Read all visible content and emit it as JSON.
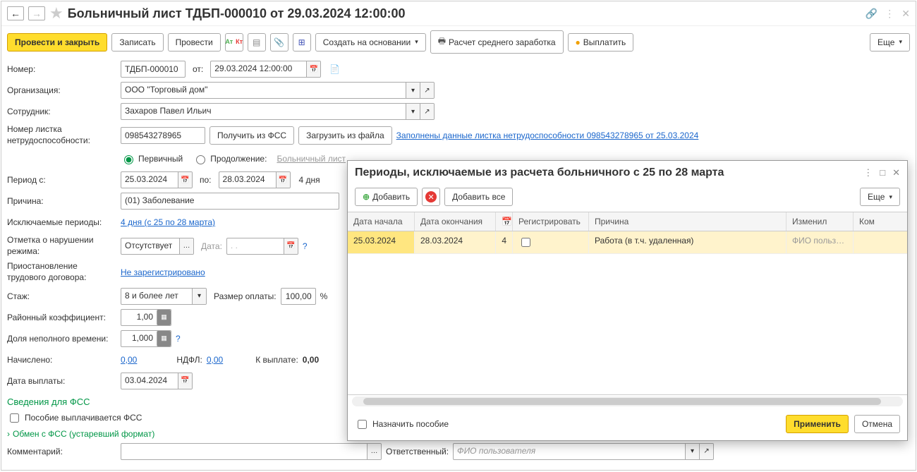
{
  "title": "Больничный лист ТДБП-000010 от 29.03.2024 12:00:00",
  "toolbar": {
    "post_close": "Провести и закрыть",
    "save": "Записать",
    "post": "Провести",
    "create_based": "Создать на основании",
    "avg_calc": "Расчет среднего заработка",
    "pay": "Выплатить",
    "more": "Еще"
  },
  "labels": {
    "number": "Номер:",
    "from": "от:",
    "org": "Организация:",
    "employee": "Сотрудник:",
    "cert_number": "Номер листка нетрудоспособности:",
    "get_fss": "Получить из ФСС",
    "load_file": "Загрузить из файла",
    "cert_link": "Заполнены данные листка нетрудоспособности 098543278965 от 25.03.2024",
    "primary": "Первичный",
    "continuation": "Продолжение:",
    "sick_leave_link": "Больничный лист",
    "period_from": "Период с:",
    "period_to": "по:",
    "days": "4 дня",
    "reason": "Причина:",
    "excl_periods": "Исключаемые периоды:",
    "excl_link": "4 дня (с 25 по 28 марта)",
    "violation": "Отметка о нарушении режима:",
    "date_lbl": "Дата:",
    "suspension": "Приостановление трудового договора:",
    "not_registered": "Не зарегистрировано",
    "seniority": "Стаж:",
    "pay_rate": "Размер оплаты:",
    "pct": "%",
    "district": "Районный коэффициент:",
    "parttime": "Доля неполного времени:",
    "accrued": "Начислено:",
    "ndfl": "НДФЛ:",
    "to_pay": "К выплате:",
    "pay_date": "Дата выплаты:",
    "fss_section": "Сведения для ФСС",
    "fss_pays": "Пособие выплачивается ФСС",
    "fss_exchange": "Обмен с ФСС (устаревший формат)",
    "comment": "Комментарий:",
    "responsible": "Ответственный:",
    "responsible_value": "ФИО пользователя"
  },
  "values": {
    "number": "ТДБП-000010",
    "date": "29.03.2024 12:00:00",
    "org": "ООО \"Торговый дом\"",
    "employee": "Захаров Павел Ильич",
    "cert_number": "098543278965",
    "period_from": "25.03.2024",
    "period_to": "28.03.2024",
    "reason": "(01) Заболевание",
    "violation": "Отсутствует",
    "date_empty": "  .  .    ",
    "seniority": "8 и более лет",
    "pay_rate": "100,00",
    "district": "1,00",
    "parttime": "1,000",
    "accrued": "0,00",
    "ndfl": "0,00",
    "to_pay": "0,00",
    "pay_date": "03.04.2024"
  },
  "modal": {
    "title": "Периоды, исключаемые из расчета больничного с 25 по 28 марта",
    "add": "Добавить",
    "add_all": "Добавить все",
    "more": "Еще",
    "cols": {
      "start": "Дата начала",
      "end": "Дата окончания",
      "days_icon": "",
      "register": "Регистрировать",
      "reason": "Причина",
      "changed": "Изменил",
      "comment": "Ком"
    },
    "row": {
      "start": "25.03.2024",
      "end": "28.03.2024",
      "days": "4",
      "register": false,
      "reason": "Работа (в т.ч. удаленная)",
      "changed": "ФИО польз…"
    },
    "assign_benefit": "Назначить пособие",
    "apply": "Применить",
    "cancel": "Отмена"
  }
}
